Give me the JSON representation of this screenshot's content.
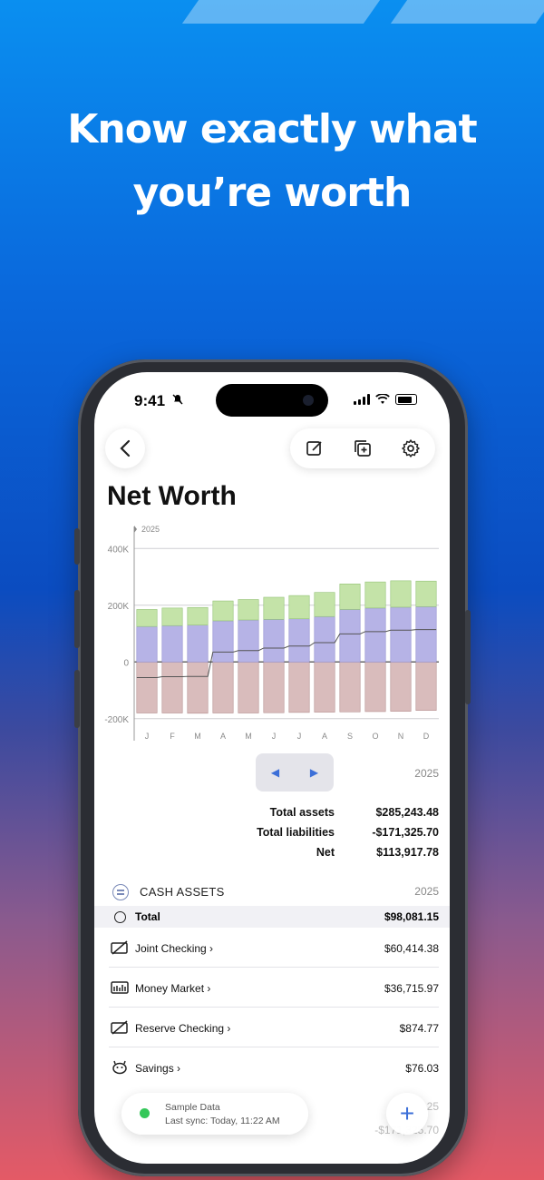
{
  "promo": {
    "headline_line1": "Know exactly what",
    "headline_line2": "you’re worth"
  },
  "status_bar": {
    "time": "9:41"
  },
  "page": {
    "title": "Net Worth"
  },
  "chart_data": {
    "type": "bar",
    "stacked": true,
    "year_label": "2025",
    "categories": [
      "J",
      "F",
      "M",
      "A",
      "M",
      "J",
      "J",
      "A",
      "S",
      "O",
      "N",
      "D"
    ],
    "y_tick_labels": [
      "400K",
      "200K",
      "0",
      "-200K"
    ],
    "ylim": [
      -220000,
      420000
    ],
    "series": [
      {
        "values": [
          -180000,
          -180000,
          -181000,
          -180000,
          -180000,
          -179000,
          -178000,
          -177000,
          -176000,
          -175000,
          -174000,
          -171000
        ],
        "color": "#d9bcbc"
      },
      {
        "values": [
          125000,
          128000,
          130000,
          145000,
          148000,
          150000,
          152000,
          160000,
          185000,
          190000,
          193000,
          195000
        ],
        "color": "#b6b3e6"
      },
      {
        "values": [
          60000,
          62000,
          62000,
          70000,
          72000,
          78000,
          82000,
          85000,
          90000,
          92000,
          93000,
          90000
        ],
        "color": "#c4e3a8"
      }
    ],
    "net_line": [
      -55000,
      -52000,
      -51000,
      35000,
      40000,
      49000,
      56000,
      68000,
      99000,
      107000,
      112000,
      114000
    ],
    "grid": true
  },
  "pager": {
    "prev": "◀",
    "next": "▶",
    "year": "2025"
  },
  "summary": [
    {
      "label": "Total assets",
      "value": "$285,243.48"
    },
    {
      "label": "Total liabilities",
      "value": "-$171,325.70"
    },
    {
      "label": "Net",
      "value": "$113,917.78"
    }
  ],
  "cash_assets": {
    "header": "CASH ASSETS",
    "year": "2025",
    "total_label": "Total",
    "total_value": "$98,081.15",
    "accounts": [
      {
        "name": "Joint Checking",
        "value": "$60,414.38",
        "icon": "card-icon"
      },
      {
        "name": "Money Market",
        "value": "$36,715.97",
        "icon": "bank-icon"
      },
      {
        "name": "Reserve Checking",
        "value": "$874.77",
        "icon": "card-icon"
      },
      {
        "name": "Savings",
        "value": "$76.03",
        "icon": "piggy-icon"
      }
    ]
  },
  "faded": {
    "year": "25",
    "value": "-$171,325.70"
  },
  "sync": {
    "title": "Sample Data",
    "detail": "Last sync: Today, 11:22 AM"
  },
  "add_label": "+"
}
